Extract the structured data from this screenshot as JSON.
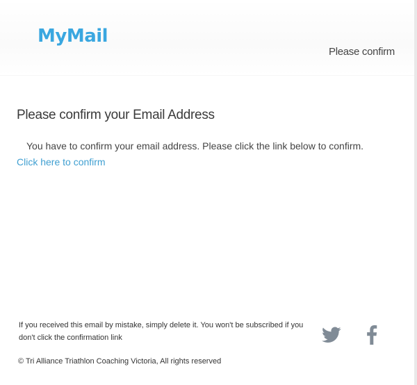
{
  "header": {
    "logo_text": "MyMail",
    "title": "Please confirm"
  },
  "main": {
    "heading": "Please confirm your Email Address",
    "message": "You have to confirm your email address. Please click the link below to confirm.",
    "confirm_link": "Click here to confirm"
  },
  "footer": {
    "disclaimer": "If you received this email by mistake, simply delete it. You won't be subscribed if you don't click the confirmation link",
    "copyright": "©  Tri Alliance Triathlon Coaching Victoria, All rights reserved",
    "social": [
      {
        "icon": "twitter-icon"
      },
      {
        "icon": "facebook-icon"
      }
    ]
  },
  "colors": {
    "brand": "#3aa7e0",
    "link": "#3f9fd1",
    "social_icon": "#808b96"
  }
}
